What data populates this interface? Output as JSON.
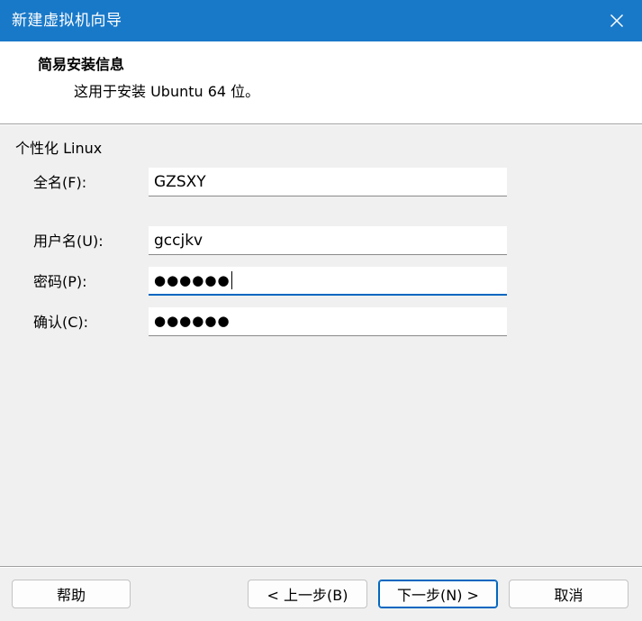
{
  "window": {
    "title": "新建虚拟机向导"
  },
  "header": {
    "title": "简易安装信息",
    "subtitle": "这用于安装 Ubuntu 64 位。"
  },
  "form": {
    "group_label": "个性化 Linux",
    "fullname": {
      "label": "全名(F):",
      "value": "GZSXY"
    },
    "username": {
      "label": "用户名(U):",
      "value": "gccjkv"
    },
    "password": {
      "label": "密码(P):",
      "value": "●●●●●●"
    },
    "confirm": {
      "label": "确认(C):",
      "value": "●●●●●●"
    }
  },
  "buttons": {
    "help": "帮助",
    "back": "< 上一步(B)",
    "next": "下一步(N) >",
    "cancel": "取消"
  },
  "colors": {
    "titlebar": "#1979c9",
    "focus_accent": "#0067c0"
  }
}
